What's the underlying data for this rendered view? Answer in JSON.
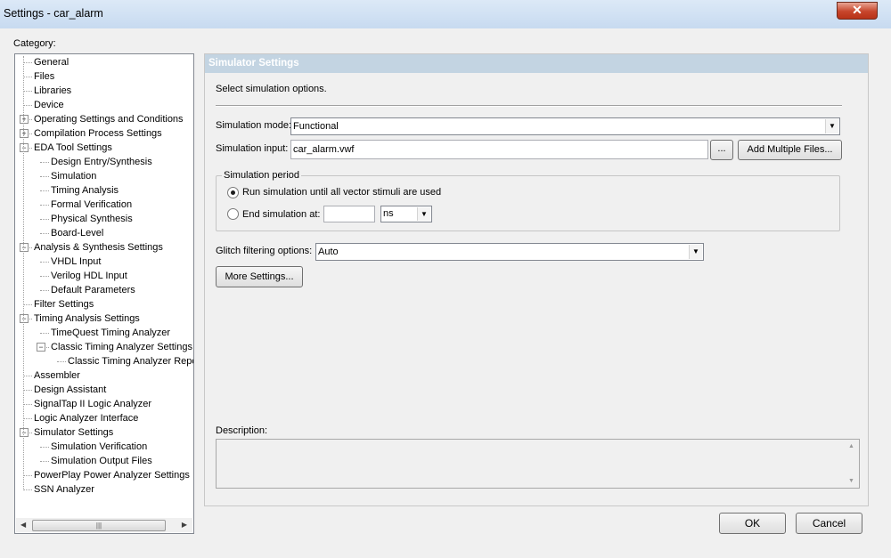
{
  "window": {
    "title": "Settings - car_alarm",
    "close_glyph": "✕"
  },
  "category_label": "Category:",
  "tree": [
    {
      "label": "General"
    },
    {
      "label": "Files"
    },
    {
      "label": "Libraries"
    },
    {
      "label": "Device"
    },
    {
      "label": "Operating Settings and Conditions",
      "expander": "+"
    },
    {
      "label": "Compilation Process Settings",
      "expander": "+"
    },
    {
      "label": "EDA Tool Settings",
      "expander": "−"
    },
    {
      "label": "Design Entry/Synthesis"
    },
    {
      "label": "Simulation"
    },
    {
      "label": "Timing Analysis"
    },
    {
      "label": "Formal Verification"
    },
    {
      "label": "Physical Synthesis"
    },
    {
      "label": "Board-Level"
    },
    {
      "label": "Analysis & Synthesis Settings",
      "expander": "−"
    },
    {
      "label": "VHDL Input"
    },
    {
      "label": "Verilog HDL Input"
    },
    {
      "label": "Default Parameters"
    },
    {
      "label": "Filter Settings"
    },
    {
      "label": "Timing Analysis Settings",
      "expander": "−"
    },
    {
      "label": "TimeQuest Timing Analyzer"
    },
    {
      "label": "Classic Timing Analyzer Settings",
      "expander": "−"
    },
    {
      "label": "Classic Timing Analyzer Reports"
    },
    {
      "label": "Assembler"
    },
    {
      "label": "Design Assistant"
    },
    {
      "label": "SignalTap II Logic Analyzer"
    },
    {
      "label": "Logic Analyzer Interface"
    },
    {
      "label": "Simulator Settings",
      "expander": "−",
      "selected": true
    },
    {
      "label": "Simulation Verification"
    },
    {
      "label": "Simulation Output Files"
    },
    {
      "label": "PowerPlay Power Analyzer Settings"
    },
    {
      "label": "SSN Analyzer"
    }
  ],
  "panel": {
    "header": "Simulator Settings",
    "intro": "Select simulation options.",
    "sim_mode": {
      "label": "Simulation mode:",
      "value": "Functional"
    },
    "sim_input": {
      "label": "Simulation input:",
      "value": "car_alarm.vwf",
      "browse": "...",
      "add_multiple": "Add Multiple Files..."
    },
    "period": {
      "title": "Simulation period",
      "opt_all": "Run simulation until all vector stimuli are used",
      "opt_end": "End simulation at:",
      "end_value": "",
      "unit": "ns",
      "selected": "opt_all"
    },
    "glitch": {
      "label": "Glitch filtering options:",
      "value": "Auto"
    },
    "more_settings": "More Settings...",
    "description_label": "Description:",
    "description": ""
  },
  "buttons": {
    "ok": "OK",
    "cancel": "Cancel"
  },
  "colors": {
    "panel_header": "#c3d4e2",
    "selection": "#3399ff"
  }
}
